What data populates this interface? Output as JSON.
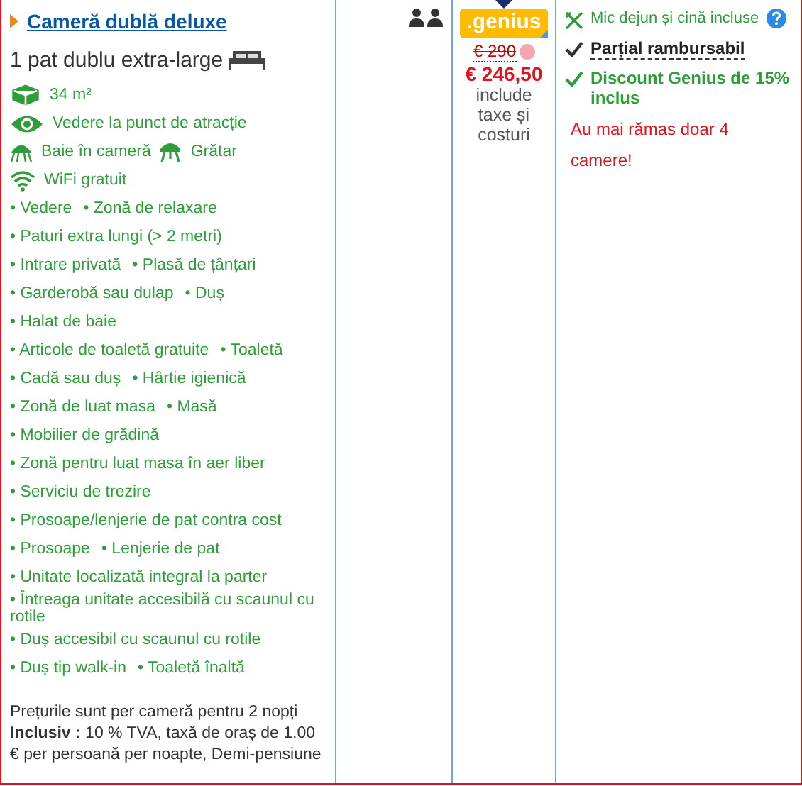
{
  "room": {
    "name": "Cameră dublă deluxe",
    "bed": "1 pat dublu extra-large",
    "feature_rows": [
      [
        {
          "kind": "size",
          "label": "34 m²"
        }
      ],
      [
        {
          "kind": "view",
          "label": "Vedere la punct de atracție"
        }
      ],
      [
        {
          "kind": "shower",
          "label": "Baie în cameră"
        },
        {
          "kind": "grill",
          "label": "Grătar"
        }
      ],
      [
        {
          "kind": "wifi",
          "label": "WiFi gratuit"
        }
      ]
    ],
    "facility_rows": [
      [
        "• Vedere",
        "• Zonă de relaxare"
      ],
      [
        "• Paturi extra lungi (> 2 metri)"
      ],
      [
        "• Intrare privată",
        "• Plasă de țânțari"
      ],
      [
        "• Garderobă sau dulap",
        "• Duș"
      ],
      [
        "• Halat de baie"
      ],
      [
        "• Articole de toaletă gratuite",
        "• Toaletă"
      ],
      [
        "• Cadă sau duș",
        "• Hârtie igienică"
      ],
      [
        "• Zonă de luat masa",
        "• Masă"
      ],
      [
        "• Mobilier de grădină"
      ],
      [
        "• Zonă pentru luat masa în aer liber"
      ],
      [
        "• Serviciu de trezire"
      ],
      [
        "• Prosoape/lenjerie de pat contra cost"
      ],
      [
        "• Prosoape",
        "• Lenjerie de pat"
      ],
      [
        "• Unitate localizată integral la parter"
      ],
      [
        "• Întreaga unitate accesibilă cu scaunul cu rotile"
      ],
      [
        "• Duș accesibil cu scaunul cu rotile"
      ],
      [
        "• Duș tip walk-in",
        "• Toaletă înaltă"
      ]
    ],
    "price_note": "Prețurile sunt per cameră pentru 2 nopți",
    "included": "**Inclusiv :** 10 % TVA, taxă de oraș de 1.00 € per persoană per noapte, Demi-pensiune"
  },
  "price": {
    "badge": ".genius",
    "old": "€ 290",
    "current": "€ 246,50",
    "note": "include taxe și costuri"
  },
  "conditions": [
    {
      "kind": "meal",
      "text": "Mic dejun și cină incluse"
    },
    {
      "kind": "refund",
      "text": "Parțial rambursabil"
    },
    {
      "kind": "discount",
      "text": "Discount Genius de 15% inclus"
    },
    {
      "kind": "scarcity",
      "text": "Au mai rămas doar 4 camere!"
    }
  ]
}
